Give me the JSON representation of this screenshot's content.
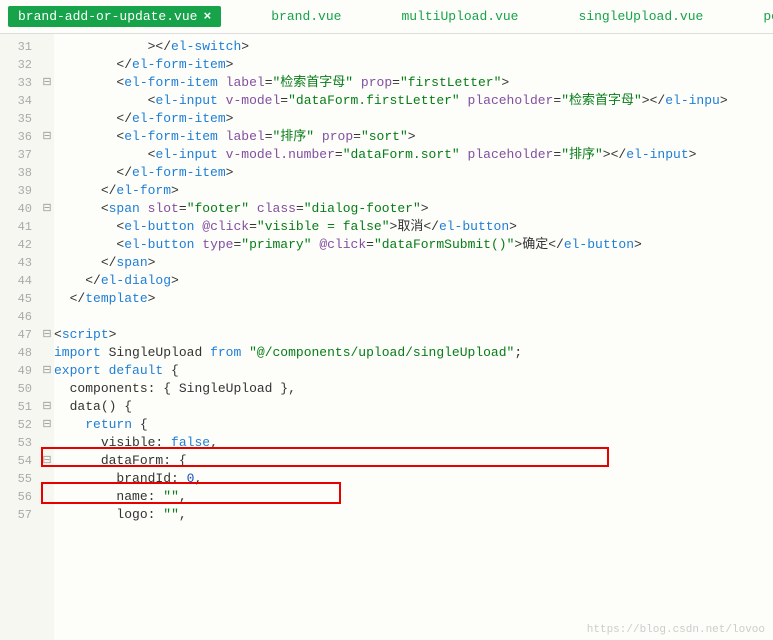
{
  "tabs": [
    {
      "label": "brand-add-or-update.vue",
      "active": true,
      "close": "×"
    },
    {
      "label": "brand.vue",
      "active": false
    },
    {
      "label": "multiUpload.vue",
      "active": false
    },
    {
      "label": "singleUpload.vue",
      "active": false
    },
    {
      "label": "policy.js",
      "active": false
    }
  ],
  "watermark": "https://blog.csdn.net/lovoo",
  "lines": {
    "start": 31,
    "count": 27,
    "fold": {
      "33": "⊟",
      "36": "⊟",
      "40": "⊟",
      "47": "⊟",
      "49": "⊟",
      "51": "⊟",
      "52": "⊟",
      "54": "⊟"
    }
  },
  "code": {
    "l31": {
      "indent": "            ",
      "close_tag": "el-switch"
    },
    "l32": {
      "indent": "        ",
      "close_tag": "el-form-item"
    },
    "l33": {
      "indent": "        ",
      "tag": "el-form-item",
      "a1": "label",
      "v1": "检索首字母",
      "a2": "prop",
      "v2": "firstLetter"
    },
    "l34": {
      "indent": "            ",
      "tag": "el-input",
      "a1": "v-model",
      "v1": "dataForm.firstLetter",
      "a2": "placeholder",
      "v2": "检索首字母",
      "close_tag": "el-inpu"
    },
    "l35": {
      "indent": "        ",
      "close_tag": "el-form-item"
    },
    "l36": {
      "indent": "        ",
      "tag": "el-form-item",
      "a1": "label",
      "v1": "排序",
      "a2": "prop",
      "v2": "sort"
    },
    "l37": {
      "indent": "            ",
      "tag": "el-input",
      "a1": "v-model.number",
      "v1": "dataForm.sort",
      "a2": "placeholder",
      "v2": "排序",
      "close_tag": "el-input"
    },
    "l38": {
      "indent": "        ",
      "close_tag": "el-form-item"
    },
    "l39": {
      "indent": "      ",
      "close_tag": "el-form"
    },
    "l40": {
      "indent": "      ",
      "tag": "span",
      "a1": "slot",
      "v1": "footer",
      "a2": "class",
      "v2": "dialog-footer"
    },
    "l41": {
      "indent": "        ",
      "tag": "el-button",
      "a1": "@click",
      "v1": "visible = false",
      "text": "取消",
      "close_tag": "el-button"
    },
    "l42": {
      "indent": "        ",
      "tag": "el-button",
      "a1": "type",
      "v1": "primary",
      "a2": "@click",
      "v2": "dataFormSubmit()",
      "text": "确定",
      "close_tag": "el-button"
    },
    "l43": {
      "indent": "      ",
      "close_tag": "span"
    },
    "l44": {
      "indent": "    ",
      "close_tag": "el-dialog"
    },
    "l45": {
      "indent": "  ",
      "close_tag": "template"
    },
    "l46": {
      "blank": true
    },
    "l47": {
      "open_tag": "script"
    },
    "l48": {
      "kw1": "import",
      "id1": "SingleUpload",
      "kw2": "from",
      "str": "@/components/upload/singleUpload",
      "semi": ";"
    },
    "l49": {
      "kw1": "export",
      "kw2": "default",
      "brace": "{"
    },
    "l50": {
      "indent": "  ",
      "key": "components",
      "val": "{ SingleUpload }",
      "comma": ","
    },
    "l51": {
      "indent": "  ",
      "fn": "data",
      "paren": "()",
      "brace": "{"
    },
    "l52": {
      "indent": "    ",
      "kw": "return",
      "brace": "{"
    },
    "l53": {
      "indent": "      ",
      "key": "visible",
      "valbool": "false",
      "comma": ","
    },
    "l54": {
      "indent": "      ",
      "key": "dataForm",
      "brace": "{",
      "comma2": ""
    },
    "l55": {
      "indent": "        ",
      "key": "brandId",
      "valnum": "0",
      "comma": ","
    },
    "l56": {
      "indent": "        ",
      "key": "name",
      "valstr": "\"\"",
      "comma": ","
    },
    "l57": {
      "indent": "        ",
      "key": "logo",
      "valstr": "\"\"",
      "comma": ","
    }
  }
}
